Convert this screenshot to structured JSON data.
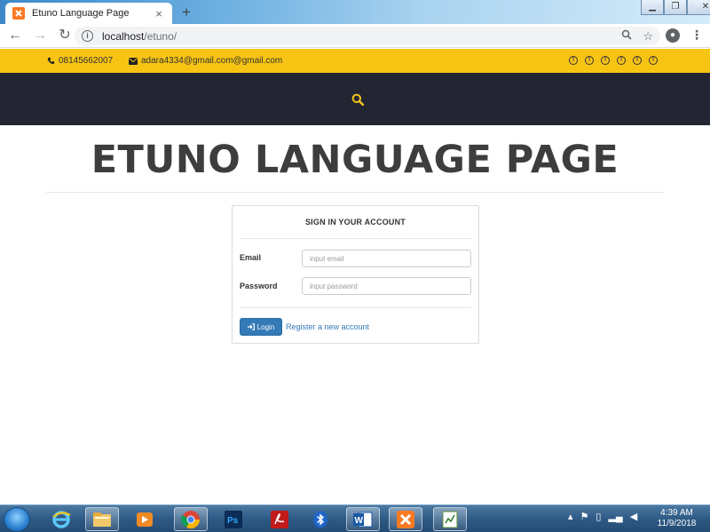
{
  "browser": {
    "tab_title": "Etuno Language Page",
    "tab_close": "×",
    "new_tab": "+",
    "url_host": "localhost",
    "url_path": "/etuno/"
  },
  "topbar": {
    "phone": "08145662007",
    "email": "adara4334@gmail.com@gmail.com",
    "social_icons": [
      "info-circle-icon",
      "info-circle-icon",
      "info-circle-icon",
      "info-circle-icon",
      "info-circle-icon",
      "info-circle-icon"
    ]
  },
  "page": {
    "title": "ETUNO LANGUAGE PAGE"
  },
  "login": {
    "heading": "SIGN IN YOUR ACCOUNT",
    "email_label": "Email",
    "email_placeholder": "input email",
    "password_label": "Password",
    "password_placeholder": "input password",
    "login_button": "Login",
    "register_link": "Register a new account"
  },
  "taskbar": {
    "apps": [
      "internet-explorer-icon",
      "file-explorer-icon",
      "media-player-icon",
      "chrome-icon",
      "photoshop-icon",
      "acrobat-icon",
      "bluetooth-icon",
      "word-icon",
      "xampp-icon",
      "notepad-icon"
    ],
    "time": "4:39 AM",
    "date": "11/9/2018"
  },
  "colors": {
    "topbar_yellow": "#f7c414",
    "navbar_dark": "#232632",
    "title_gray": "#3d3d3d",
    "button_blue": "#337ab7",
    "search_icon_yellow": "#f5c518"
  }
}
